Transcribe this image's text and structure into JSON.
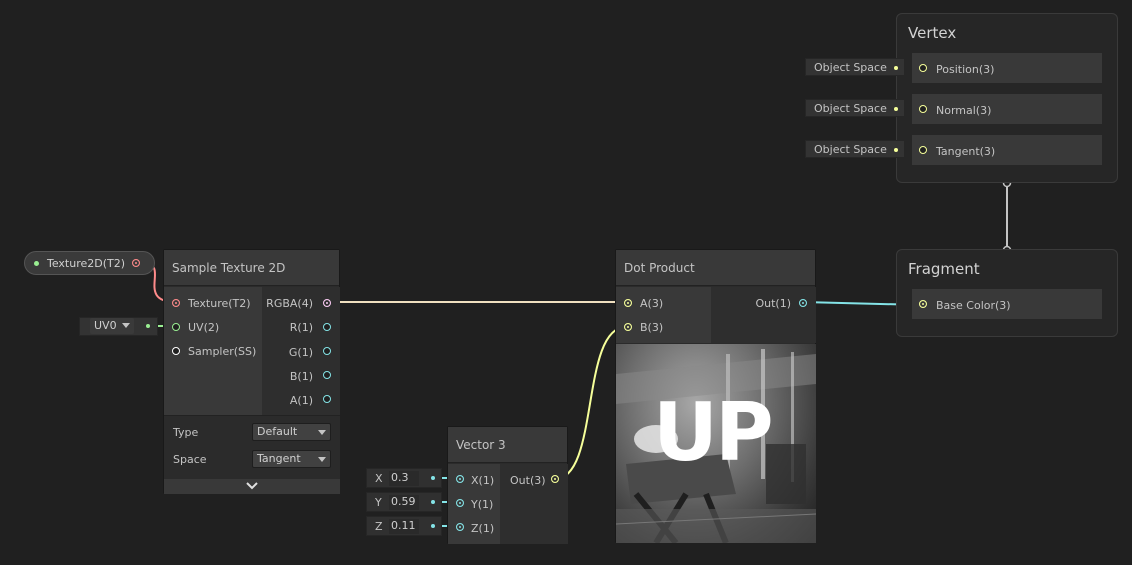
{
  "vertex": {
    "title": "Vertex",
    "blocks": [
      {
        "label": "Position(3)",
        "space": "Object Space"
      },
      {
        "label": "Normal(3)",
        "space": "Object Space"
      },
      {
        "label": "Tangent(3)",
        "space": "Object Space"
      }
    ]
  },
  "fragment": {
    "title": "Fragment",
    "blocks": [
      {
        "label": "Base Color(3)"
      }
    ]
  },
  "property": {
    "label": "Texture2D(T2)"
  },
  "uv_channel": {
    "value": "UV0"
  },
  "sample_texture": {
    "title": "Sample Texture 2D",
    "inputs": [
      "Texture(T2)",
      "UV(2)",
      "Sampler(SS)"
    ],
    "outputs": [
      "RGBA(4)",
      "R(1)",
      "G(1)",
      "B(1)",
      "A(1)"
    ],
    "type_label": "Type",
    "type_value": "Default",
    "space_label": "Space",
    "space_value": "Tangent"
  },
  "dot_product": {
    "title": "Dot Product",
    "inputs": [
      "A(3)",
      "B(3)"
    ],
    "output": "Out(1)",
    "preview_text": "UP"
  },
  "vector3": {
    "title": "Vector 3",
    "inputs": [
      "X(1)",
      "Y(1)",
      "Z(1)"
    ],
    "output": "Out(3)",
    "fields": [
      {
        "axis": "X",
        "value": "0.3"
      },
      {
        "axis": "Y",
        "value": "0.59"
      },
      {
        "axis": "Z",
        "value": "0.11"
      }
    ]
  },
  "colors": {
    "vector1": "#84e4e7",
    "vector2": "#9aef92",
    "vector3": "#f6ff9a",
    "vector4": "#fbcbf4",
    "texture": "#ff8b8b",
    "sampler": "#ffffff"
  }
}
